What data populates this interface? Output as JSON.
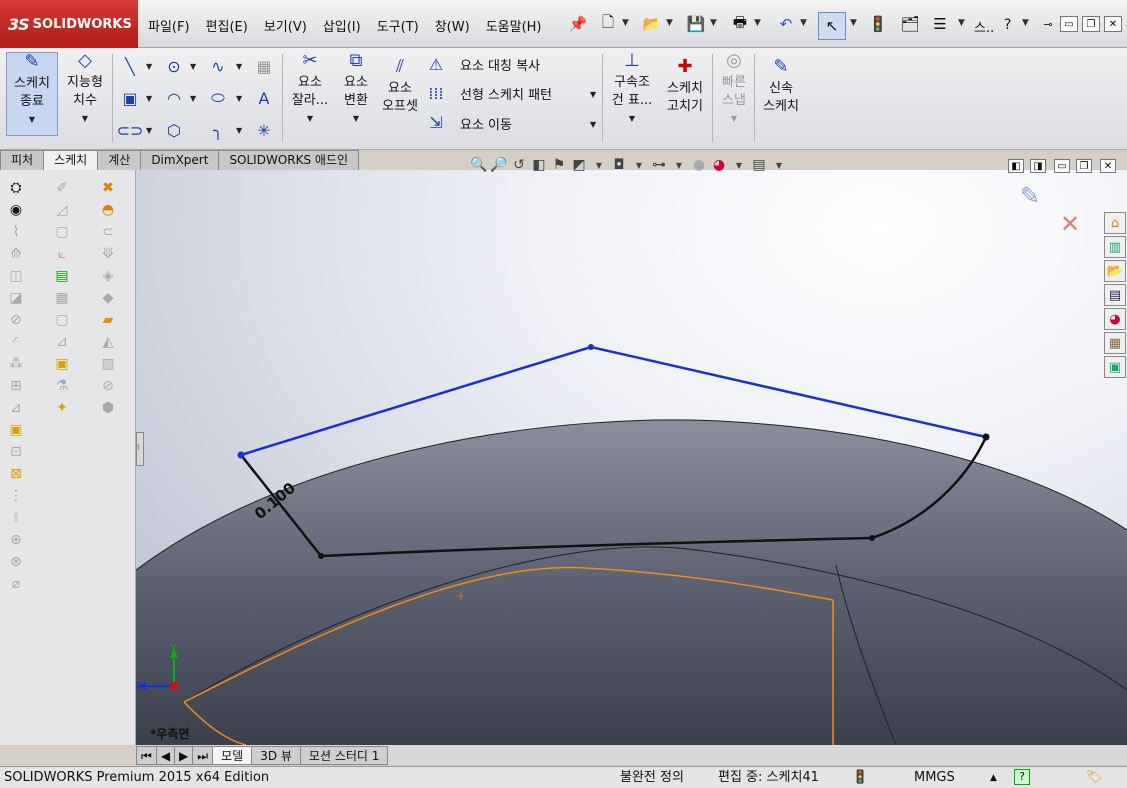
{
  "app": {
    "brand": "SOLIDWORKS",
    "brand_mark": "3S",
    "help_symbol": "?",
    "search_short": "스.."
  },
  "menu": [
    "파일(F)",
    "편집(E)",
    "보기(V)",
    "삽입(I)",
    "도구(T)",
    "창(W)",
    "도움말(H)"
  ],
  "command_manager": {
    "exit_sketch": "스케치\n종료",
    "smart_dim": "지능형\n치수",
    "trim": "요소\n잘라...",
    "convert": "요소\n변환",
    "offset": "요소\n오프셋",
    "mirror": "요소 대칭 복사",
    "linear_pattern": "선형 스케치 패턴",
    "move": "요소 이동",
    "relations": "구속조\n건 표...",
    "repair": "스케치\n고치기",
    "quick_snaps": "빠른\n스냅",
    "rapid_sketch": "신속\n스케치"
  },
  "tabs": [
    "피처",
    "스케치",
    "계산",
    "DimXpert",
    "SOLIDWORKS 애드인"
  ],
  "active_tab": "스케치",
  "viewport": {
    "dimension_label": "0.100",
    "view_name": "*우측면",
    "triad_y": "Y",
    "triad_z": "Z"
  },
  "bottom_tabs": [
    "모델",
    "3D 뷰",
    "모션 스터디 1"
  ],
  "active_bottom_tab": "모델",
  "status": {
    "edition": "SOLIDWORKS Premium 2015 x64 Edition",
    "state": "불완전 정의",
    "editing": "편집 중: 스케치41",
    "units": "MMGS"
  },
  "colors": {
    "sketch_blue": "#1a2fd4",
    "edge_orange": "#f08a1c",
    "brand_red": "#c8241f",
    "surface": "#5a5e6e"
  }
}
